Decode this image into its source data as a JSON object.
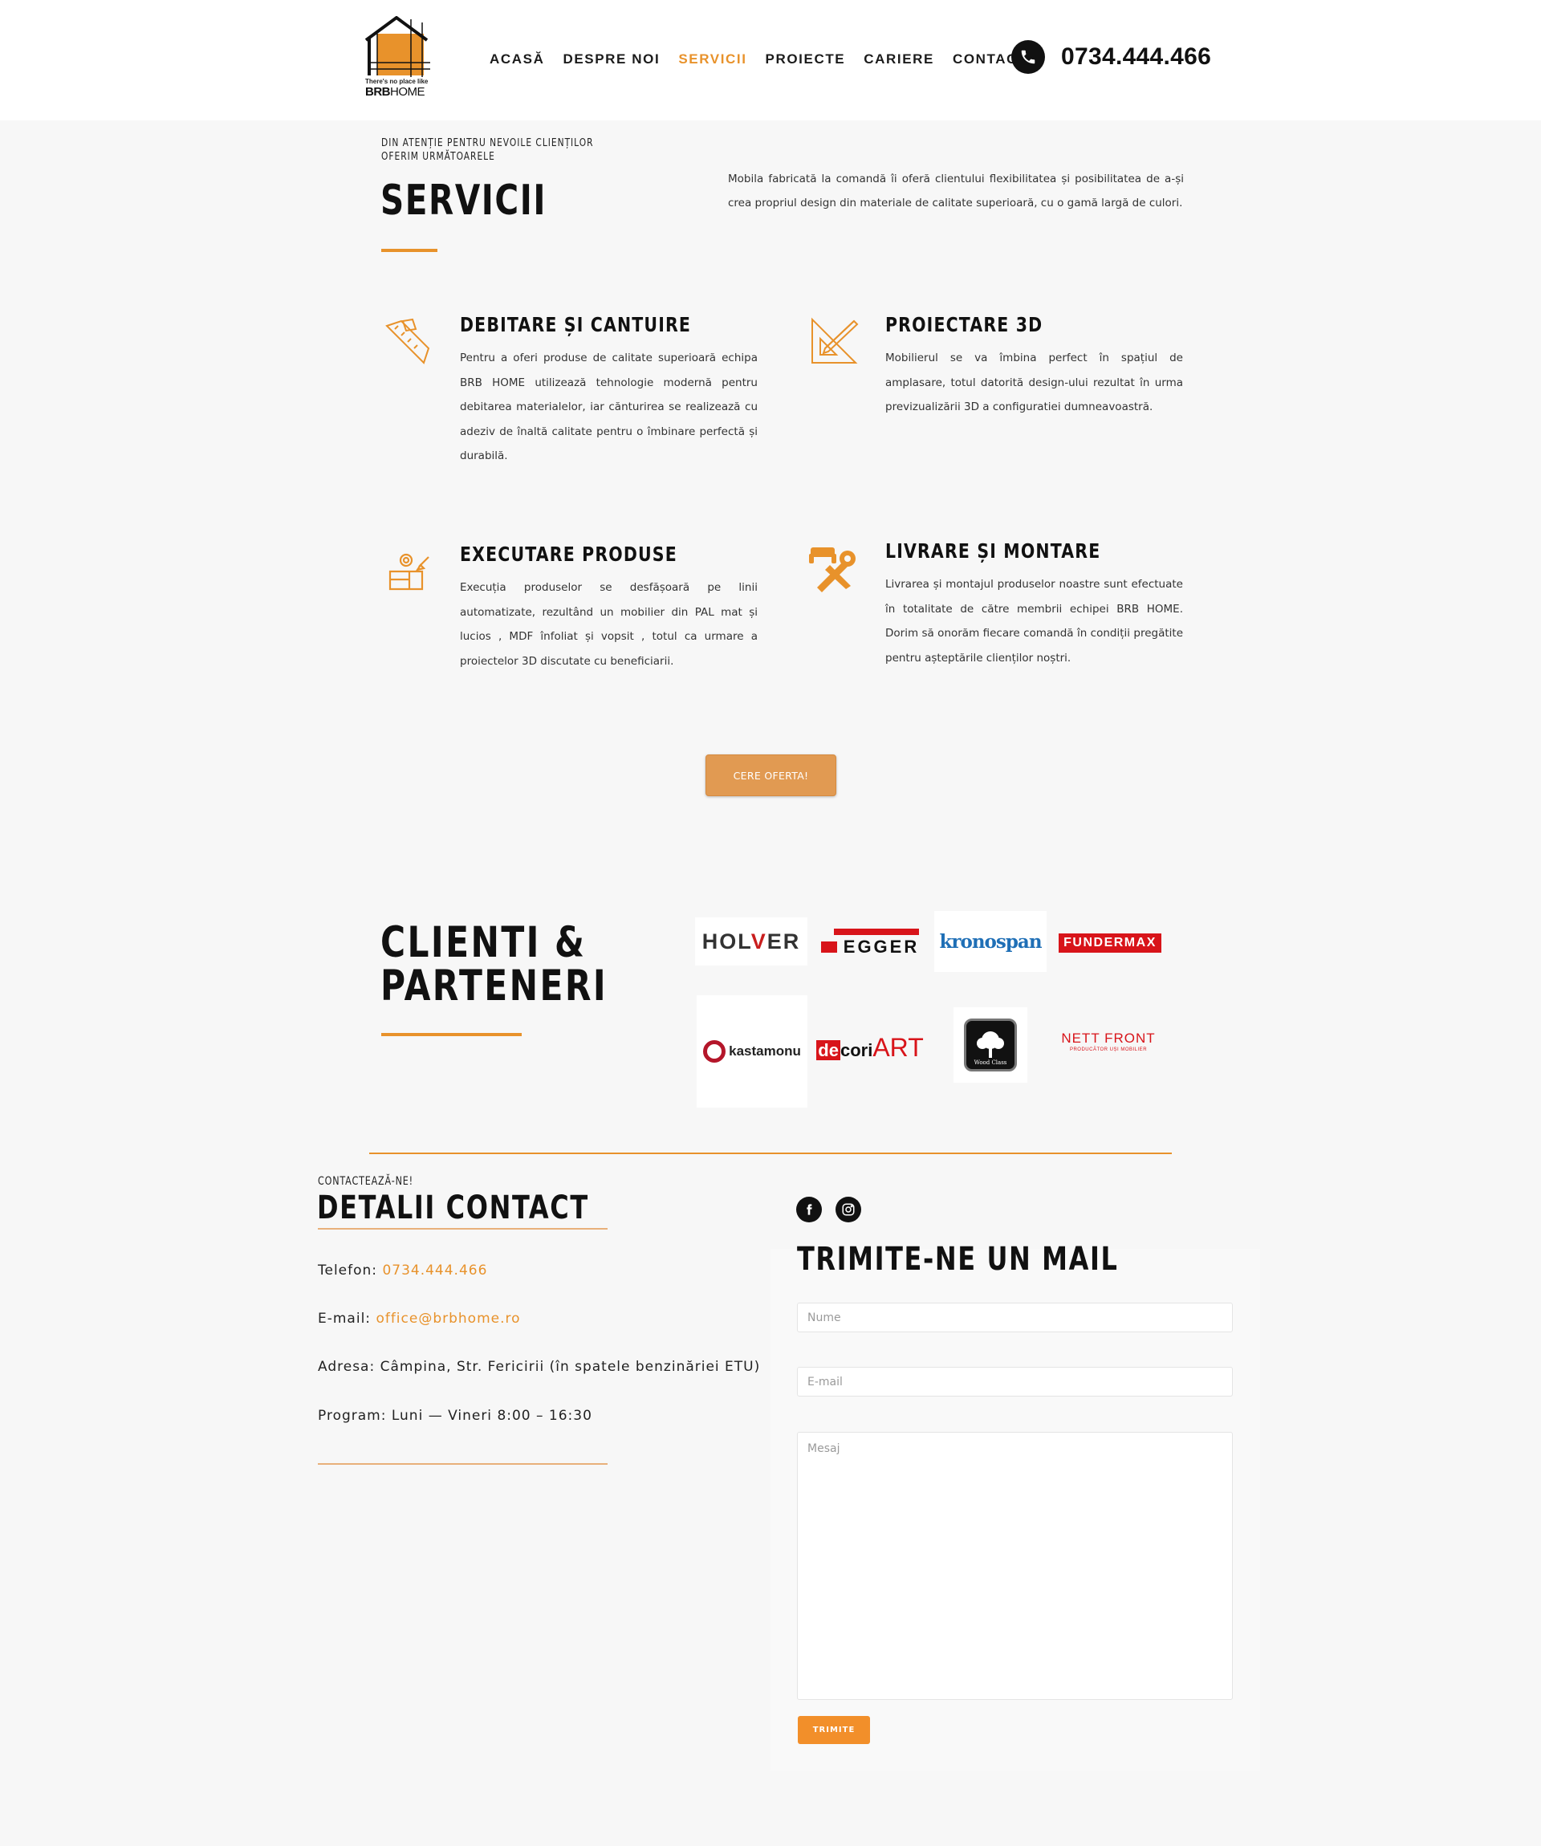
{
  "header": {
    "logo_tagline": "There's no place like",
    "logo_brand_bold": "BRB",
    "logo_brand_light": "HOME",
    "nav": [
      "ACASĂ",
      "DESPRE NOI",
      "SERVICII",
      "PROIECTE",
      "CARIERE",
      "CONTACT"
    ],
    "active_nav": "SERVICII",
    "phone": "0734.444.466",
    "phone_icon": "phone-icon"
  },
  "services_intro": {
    "kicker": "DIN ATENȚIE PENTRU NEVOILE CLIENȚILOR OFERIM URMĂTOARELE",
    "title": "SERVICII",
    "text": "Mobila fabricată la comandă îi oferă clientului flexibilitatea și posibilitatea de a-și crea propriul design din materiale de calitate superioară, cu o gamă largă de culori."
  },
  "services": [
    {
      "title": "DEBITARE ȘI CANTUIRE",
      "icon": "ruler-pencil-icon",
      "text": "Pentru a oferi produse de calitate superioară echipa BRB HOME utilizează tehnologie modernă pentru debitarea materialelor, iar cănturirea se realizează cu adeziv de înaltă calitate pentru o îmbinare perfectă și durabilă."
    },
    {
      "title": "PROIECTARE 3D",
      "icon": "set-square-icon",
      "text": "Mobilierul se va îmbina perfect în spațiul de amplasare, totul datorită design-ului rezultat în urma previzualizării 3D a configuratiei dumneavoastră."
    },
    {
      "title": "EXECUTARE PRODUSE",
      "icon": "furniture-gear-icon",
      "text": "Execuția produselor se desfășoară pe linii automatizate, rezultând un mobilier din PAL mat și lucios , MDF înfoliat și vopsit , totul ca urmare a proiectelor 3D discutate cu beneficiarii."
    },
    {
      "title": "LIVRARE ȘI MONTARE",
      "icon": "wrench-sofa-icon",
      "text": "Livrarea și montajul produselor noastre sunt efectuate în totalitate de către membrii echipei BRB HOME. Dorim să onorăm fiecare comandă în condiții pregătite pentru așteptările clienților noștri."
    }
  ],
  "cta_label": "CERE OFERTA!",
  "partners": {
    "title_line1": "CLIENTI &",
    "title_line2": "PARTENERI",
    "logos": [
      "HOLVER",
      "EGGER",
      "kronospan",
      "FUNDERMAX",
      "kastamonu",
      "decoriART",
      "Wood Class",
      "NETT FRONT"
    ]
  },
  "logo_text": {
    "holver_a": "HOL",
    "holver_b": "V",
    "holver_c": "ER",
    "egger": "EGGER",
    "krono": "kronospan",
    "fundermax": "FUNDERMAX",
    "kastamonu": "kastamonu",
    "decori_de": "de",
    "decori_cori": "cori",
    "decori_art": "ART",
    "wood": "Wood Class",
    "nett": "NETT FRONT",
    "nett_sub": "PRODUCĂTOR UȘI MOBILIER"
  },
  "contact": {
    "kicker": "CONTACTEAZĂ-NE!",
    "title": "DETALII CONTACT",
    "phone_label": "Telefon: ",
    "phone_value": "0734.444.466",
    "email_label": "E-mail: ",
    "email_value": "office@brbhome.ro",
    "address": "Adresa: Câmpina, Str. Fericirii (în spatele benzinăriei ETU)",
    "program": "Program: Luni — Vineri 8:00 – 16:30",
    "social_icons": [
      "facebook-icon",
      "instagram-icon"
    ]
  },
  "form": {
    "title": "TRIMITE-NE UN MAIL",
    "name_placeholder": "Nume",
    "email_placeholder": "E-mail",
    "message_placeholder": "Mesaj",
    "submit_label": "TRIMITE"
  },
  "colors": {
    "accent": "#e8922b",
    "cta": "#e19a52",
    "dark": "#111111",
    "background": "#f7f7f7"
  }
}
